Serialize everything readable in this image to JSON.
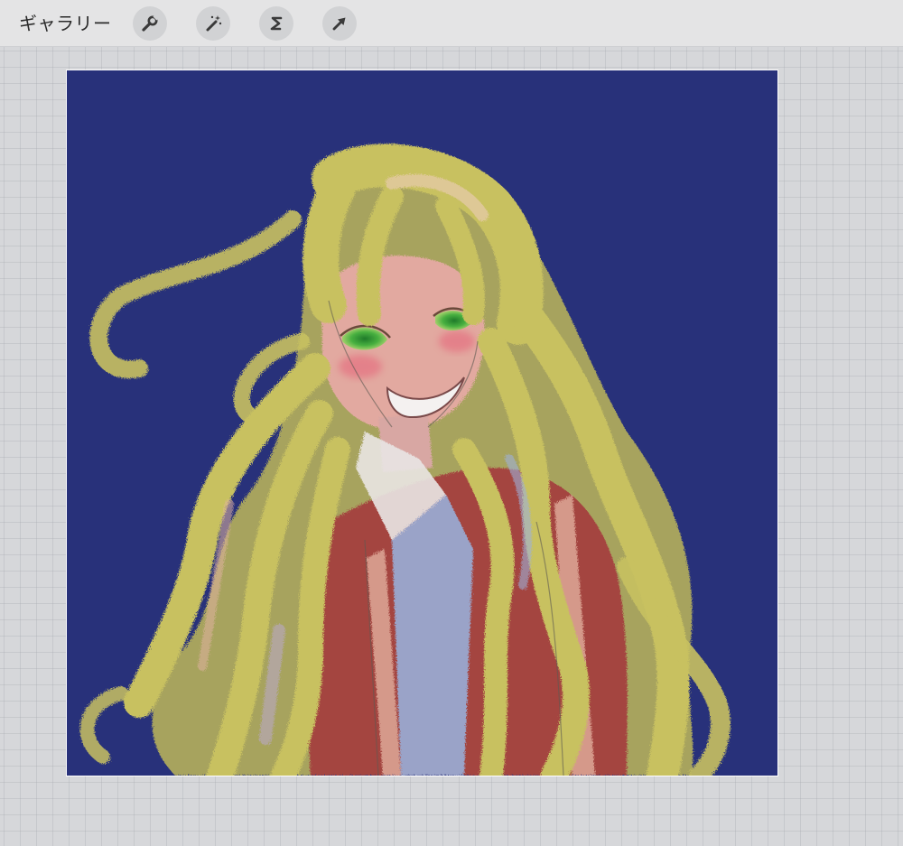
{
  "toolbar": {
    "gallery_label": "ギャラリー",
    "tools": [
      {
        "name": "actions",
        "icon": "wrench-icon"
      },
      {
        "name": "adjustments",
        "icon": "magic-wand-icon"
      },
      {
        "name": "selection",
        "icon": "selection-s-icon"
      },
      {
        "name": "transform",
        "icon": "arrow-cursor-icon"
      }
    ]
  },
  "canvas": {
    "background_color": "#28317a",
    "artwork": "illustration-girl-long-blonde-hair"
  },
  "colors": {
    "toolbar_bg": "#e4e4e5",
    "workspace_bg": "#d6d7da",
    "hair": "#c7c060",
    "jacket": "#a4453f",
    "eyes": "#3c9e3a"
  }
}
